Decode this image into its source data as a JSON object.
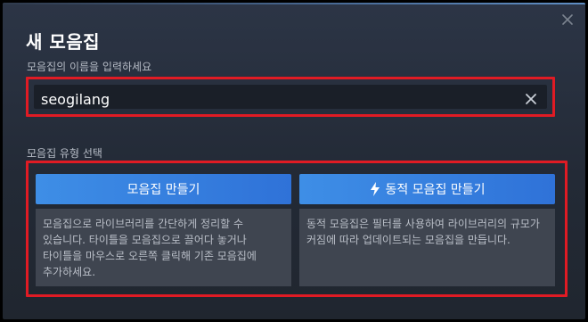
{
  "dialog": {
    "title": "새 모음집",
    "close_icon": "close-icon"
  },
  "name_field": {
    "label": "모음집의 이름을 입력하세요",
    "value": "seogilang",
    "clear_icon": "clear-icon"
  },
  "collection_type": {
    "label": "모음집 유형 선택",
    "options": [
      {
        "button_label": "모음집 만들기",
        "description": "모음집으로 라이브러리를 간단하게 정리할 수 있습니다. 타이틀을 모음집으로 끌어다 놓거나 타이틀을 마우스로 오른쪽 클릭해 기존 모음집에 추가하세요."
      },
      {
        "button_label": "동적 모음집 만들기",
        "icon": "lightning-icon",
        "description": "동적 모음집은 필터를 사용하여 라이브러리의 규모가 커짐에 따라 업데이트되는 모음집을 만듭니다."
      }
    ]
  },
  "colors": {
    "accent": "#3e8ee6",
    "highlight_border": "#e01b24",
    "background": "#232a36"
  }
}
